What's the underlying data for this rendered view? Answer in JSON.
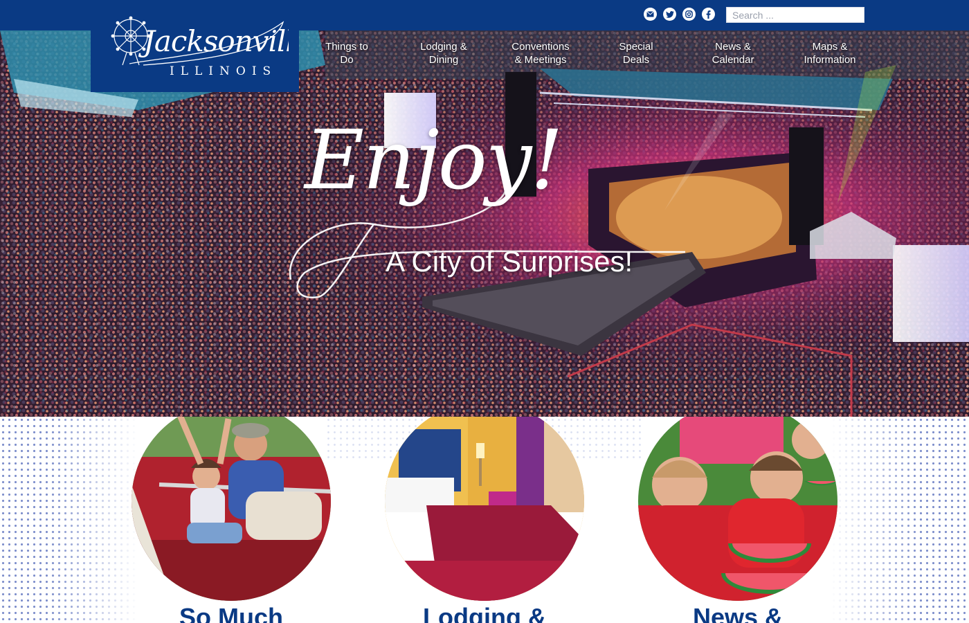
{
  "brand": {
    "logo_script": "Jacksonville",
    "logo_state": "ILLINOIS",
    "primary_color": "#0a3a84"
  },
  "topbar": {
    "social": [
      {
        "icon": "email-icon"
      },
      {
        "icon": "twitter-icon"
      },
      {
        "icon": "instagram-icon"
      },
      {
        "icon": "facebook-icon"
      }
    ],
    "search_placeholder": "Search ..."
  },
  "nav": {
    "items": [
      {
        "label": "Things to\nDo"
      },
      {
        "label": "Lodging &\nDining"
      },
      {
        "label": "Conventions\n& Meetings"
      },
      {
        "label": "Special\nDeals"
      },
      {
        "label": "News &\nCalendar"
      },
      {
        "label": "Maps &\nInformation"
      }
    ]
  },
  "hero": {
    "script_text": "Enjoy!",
    "subtitle": "A City of Surprises!"
  },
  "cards": [
    {
      "title": "So Much",
      "photo": "ferris-wheel-ride-photo"
    },
    {
      "title": "Lodging &",
      "photo": "hotel-room-photo"
    },
    {
      "title": "News &",
      "photo": "watermelon-eating-contest-photo"
    }
  ]
}
